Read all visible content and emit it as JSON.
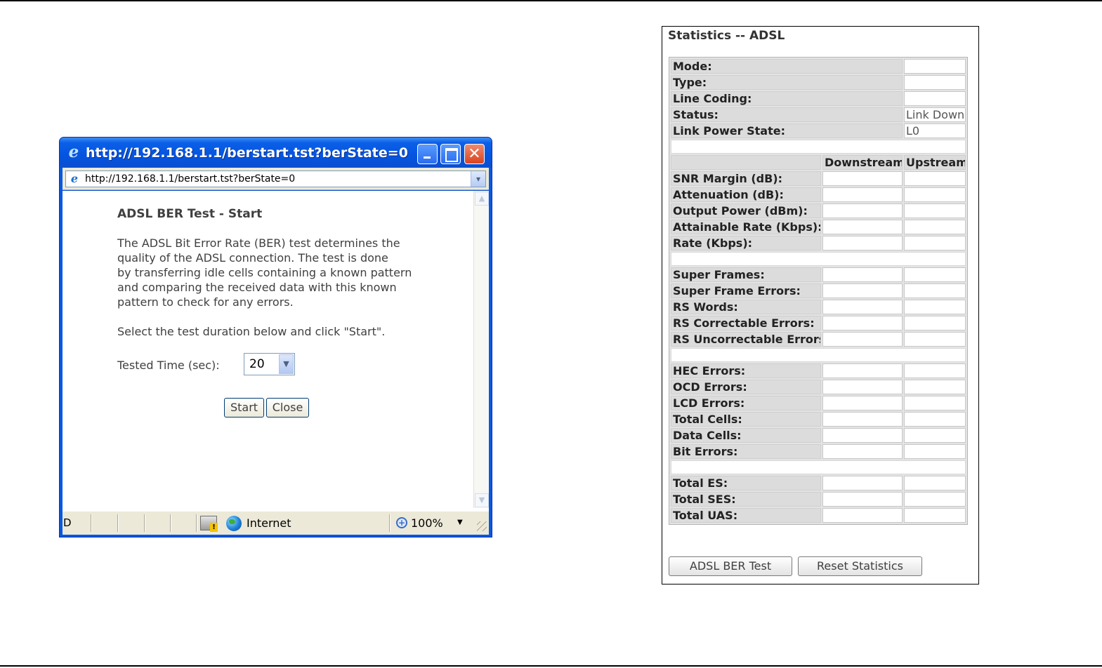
{
  "popup": {
    "title": "http://192.168.1.1/berstart.tst?berState=0 - W...",
    "address": "http://192.168.1.1/berstart.tst?berState=0",
    "heading": "ADSL BER Test - Start",
    "description": "The ADSL Bit Error Rate (BER) test determines the\nquality of the ADSL connection. The test is done\nby transferring idle cells containing a known pattern\nand comparing the received data with this known\npattern to check for any errors.",
    "instruction": "Select the test duration below and click \"Start\".",
    "tested_time_label": "Tested Time (sec):",
    "tested_time_value": "20",
    "start_button": "Start",
    "close_button": "Close",
    "status": {
      "left_text": "D",
      "zone": "Internet",
      "zoom": "100%"
    },
    "icons": {
      "title": "ie-icon",
      "address": "ie-page-icon",
      "zone": "globe-icon",
      "zoom": "zoom-icon"
    }
  },
  "stats": {
    "title": "Statistics -- ADSL",
    "general_rows": [
      {
        "label": "Mode:",
        "value": ""
      },
      {
        "label": "Type:",
        "value": ""
      },
      {
        "label": "Line Coding:",
        "value": ""
      },
      {
        "label": "Status:",
        "value": "Link Down"
      },
      {
        "label": "Link Power State:",
        "value": "L0"
      }
    ],
    "columns": {
      "downstream": "Downstream",
      "upstream": "Upstream"
    },
    "line_rows": [
      {
        "label": "SNR Margin (dB):",
        "down": "",
        "up": ""
      },
      {
        "label": "Attenuation (dB):",
        "down": "",
        "up": ""
      },
      {
        "label": "Output Power (dBm):",
        "down": "",
        "up": ""
      },
      {
        "label": "Attainable Rate (Kbps):",
        "down": "",
        "up": ""
      },
      {
        "label": "Rate (Kbps):",
        "down": "",
        "up": ""
      }
    ],
    "frame_rows": [
      {
        "label": "Super Frames:",
        "down": "",
        "up": ""
      },
      {
        "label": "Super Frame Errors:",
        "down": "",
        "up": ""
      },
      {
        "label": "RS Words:",
        "down": "",
        "up": ""
      },
      {
        "label": "RS Correctable Errors:",
        "down": "",
        "up": ""
      },
      {
        "label": "RS Uncorrectable Errors:",
        "down": "",
        "up": ""
      }
    ],
    "cell_rows": [
      {
        "label": "HEC Errors:",
        "down": "",
        "up": ""
      },
      {
        "label": "OCD Errors:",
        "down": "",
        "up": ""
      },
      {
        "label": "LCD Errors:",
        "down": "",
        "up": ""
      },
      {
        "label": "Total Cells:",
        "down": "",
        "up": ""
      },
      {
        "label": "Data Cells:",
        "down": "",
        "up": ""
      },
      {
        "label": "Bit Errors:",
        "down": "",
        "up": ""
      }
    ],
    "seconds_rows": [
      {
        "label": "Total ES:",
        "down": "",
        "up": ""
      },
      {
        "label": "Total SES:",
        "down": "",
        "up": ""
      },
      {
        "label": "Total UAS:",
        "down": "",
        "up": ""
      }
    ],
    "ber_button": "ADSL BER Test",
    "reset_button": "Reset Statistics"
  },
  "colors": {
    "xp_title_blue": "#0554e0",
    "label_cell_gray": "#dcdcdc",
    "text_gray": "#404040"
  }
}
